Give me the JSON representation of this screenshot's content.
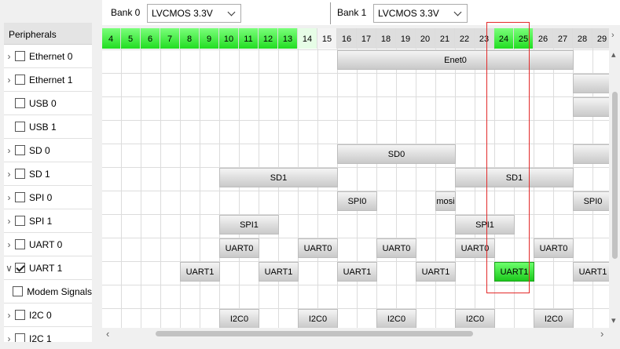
{
  "sidebar": {
    "header": "Peripherals",
    "items": [
      {
        "label": "Ethernet 0",
        "expandable": true,
        "checked": false
      },
      {
        "label": "Ethernet 1",
        "expandable": true,
        "checked": false
      },
      {
        "label": "USB 0",
        "expandable": false,
        "checked": false
      },
      {
        "label": "USB 1",
        "expandable": false,
        "checked": false
      },
      {
        "label": "SD 0",
        "expandable": true,
        "checked": false
      },
      {
        "label": "SD 1",
        "expandable": true,
        "checked": false
      },
      {
        "label": "SPI 0",
        "expandable": true,
        "checked": false
      },
      {
        "label": "SPI 1",
        "expandable": true,
        "checked": false
      },
      {
        "label": "UART 0",
        "expandable": true,
        "checked": false
      },
      {
        "label": "UART 1",
        "expandable": true,
        "expanded": true,
        "checked": true
      },
      {
        "label": "Modem Signals",
        "expandable": false,
        "checked": false,
        "child": true
      },
      {
        "label": "I2C 0",
        "expandable": true,
        "checked": false
      },
      {
        "label": "I2C 1",
        "expandable": true,
        "checked": false
      }
    ]
  },
  "banks": [
    {
      "label": "Bank 0",
      "value": "LVCMOS 3.3V"
    },
    {
      "label": "Bank 1",
      "value": "LVCMOS 3.3V"
    }
  ],
  "pins": [
    {
      "n": "4",
      "state": "green"
    },
    {
      "n": "5",
      "state": "green"
    },
    {
      "n": "6",
      "state": "green"
    },
    {
      "n": "7",
      "state": "green"
    },
    {
      "n": "8",
      "state": "green"
    },
    {
      "n": "9",
      "state": "green"
    },
    {
      "n": "10",
      "state": "green"
    },
    {
      "n": "11",
      "state": "green"
    },
    {
      "n": "12",
      "state": "green"
    },
    {
      "n": "13",
      "state": "green"
    },
    {
      "n": "14",
      "state": "light"
    },
    {
      "n": "15",
      "state": "none"
    },
    {
      "n": "16",
      "state": "gray"
    },
    {
      "n": "17",
      "state": "gray"
    },
    {
      "n": "18",
      "state": "gray"
    },
    {
      "n": "19",
      "state": "gray"
    },
    {
      "n": "20",
      "state": "gray"
    },
    {
      "n": "21",
      "state": "gray"
    },
    {
      "n": "22",
      "state": "gray"
    },
    {
      "n": "23",
      "state": "gray"
    },
    {
      "n": "24",
      "state": "green"
    },
    {
      "n": "25",
      "state": "green"
    },
    {
      "n": "26",
      "state": "gray"
    },
    {
      "n": "27",
      "state": "gray"
    },
    {
      "n": "28",
      "state": "gray"
    },
    {
      "n": "29",
      "state": "gray"
    }
  ],
  "assignments": [
    {
      "label": "Enet0",
      "row": 0,
      "pin": 16,
      "span": 12,
      "active": false
    },
    {
      "label": "",
      "row": 1,
      "pin": 28,
      "span": 2,
      "active": false
    },
    {
      "label": "",
      "row": 2,
      "pin": 28,
      "span": 2,
      "active": false
    },
    {
      "label": "SD0",
      "row": 4,
      "pin": 16,
      "span": 6,
      "active": false
    },
    {
      "label": "",
      "row": 4,
      "pin": 28,
      "span": 2,
      "active": false
    },
    {
      "label": "SD1",
      "row": 5,
      "pin": 10,
      "span": 6,
      "active": false
    },
    {
      "label": "SD1",
      "row": 5,
      "pin": 22,
      "span": 6,
      "active": false
    },
    {
      "label": "SPI0",
      "row": 6,
      "pin": 16,
      "span": 2,
      "active": false
    },
    {
      "label": "mosi",
      "row": 6,
      "pin": 21,
      "span": 1,
      "active": false
    },
    {
      "label": "SPI0",
      "row": 6,
      "pin": 28,
      "span": 2,
      "active": false
    },
    {
      "label": "SPI1",
      "row": 7,
      "pin": 10,
      "span": 3,
      "active": false
    },
    {
      "label": "SPI1",
      "row": 7,
      "pin": 22,
      "span": 3,
      "active": false
    },
    {
      "label": "UART0",
      "row": 8,
      "pin": 10,
      "span": 2,
      "active": false
    },
    {
      "label": "UART0",
      "row": 8,
      "pin": 14,
      "span": 2,
      "active": false
    },
    {
      "label": "UART0",
      "row": 8,
      "pin": 18,
      "span": 2,
      "active": false
    },
    {
      "label": "UART0",
      "row": 8,
      "pin": 22,
      "span": 2,
      "active": false
    },
    {
      "label": "UART0",
      "row": 8,
      "pin": 26,
      "span": 2,
      "active": false
    },
    {
      "label": "",
      "row": 8,
      "pin": 30,
      "span": 1,
      "active": false
    },
    {
      "label": "UART1",
      "row": 9,
      "pin": 8,
      "span": 2,
      "active": false
    },
    {
      "label": "UART1",
      "row": 9,
      "pin": 12,
      "span": 2,
      "active": false
    },
    {
      "label": "UART1",
      "row": 9,
      "pin": 16,
      "span": 2,
      "active": false
    },
    {
      "label": "UART1",
      "row": 9,
      "pin": 20,
      "span": 2,
      "active": false
    },
    {
      "label": "UART1",
      "row": 9,
      "pin": 24,
      "span": 2,
      "active": true
    },
    {
      "label": "UART1",
      "row": 9,
      "pin": 28,
      "span": 2,
      "active": false
    },
    {
      "label": "I2C0",
      "row": 11,
      "pin": 10,
      "span": 2,
      "active": false
    },
    {
      "label": "I2C0",
      "row": 11,
      "pin": 14,
      "span": 2,
      "active": false
    },
    {
      "label": "I2C0",
      "row": 11,
      "pin": 18,
      "span": 2,
      "active": false
    },
    {
      "label": "I2C0",
      "row": 11,
      "pin": 22,
      "span": 2,
      "active": false
    },
    {
      "label": "I2C0",
      "row": 11,
      "pin": 26,
      "span": 2,
      "active": false
    }
  ],
  "highlight": {
    "pins": [
      "24",
      "25"
    ],
    "color": "#e32a2a"
  },
  "colors": {
    "pin_active": "#22dd22",
    "block": "#c9c9c9",
    "selection": "#1dc91d"
  }
}
